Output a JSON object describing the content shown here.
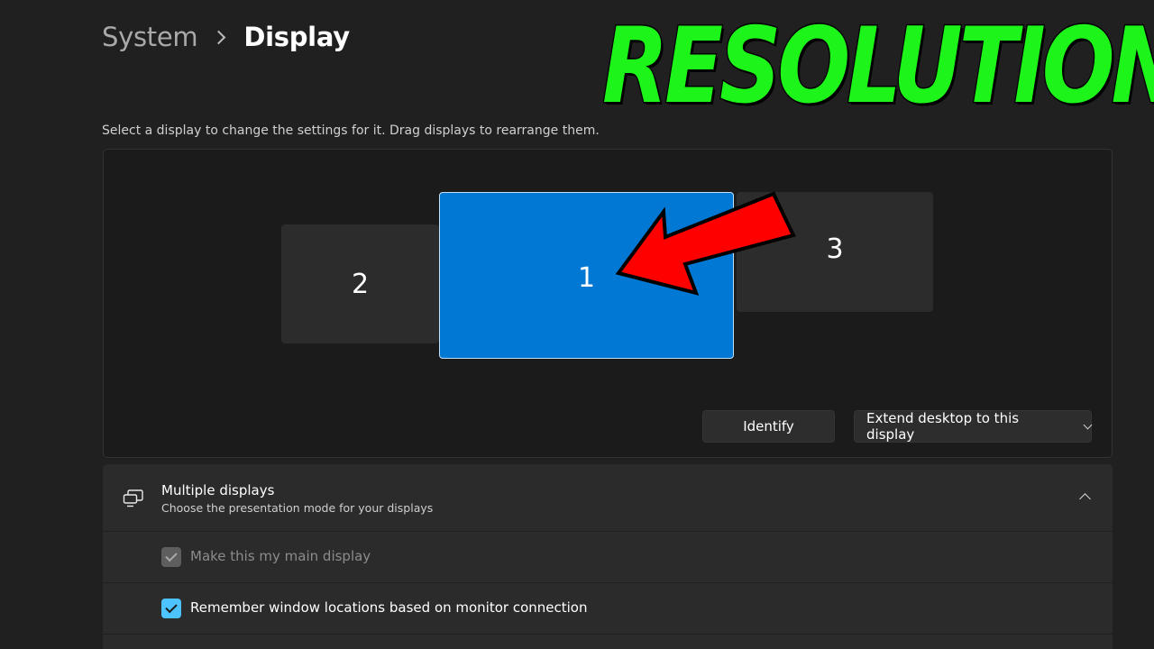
{
  "breadcrumb": {
    "parent": "System",
    "current": "Display"
  },
  "overlay_title": "RESOLUTION",
  "instruction": "Select a display to change the settings for it. Drag displays to rearrange them.",
  "monitors": {
    "left": "2",
    "center": "1",
    "right": "3"
  },
  "buttons": {
    "identify": "Identify",
    "extend": "Extend desktop to this display"
  },
  "multiple_displays": {
    "title": "Multiple displays",
    "subtitle": "Choose the presentation mode for your displays",
    "icon": "multiple-displays-icon"
  },
  "options": {
    "main_display": {
      "label": "Make this my main display",
      "checked": true,
      "disabled": true
    },
    "remember_locations": {
      "label": "Remember window locations based on monitor connection",
      "checked": true,
      "disabled": false
    }
  },
  "colors": {
    "background": "#202020",
    "accent": "#0078d4",
    "checkbox_accent": "#4cc2ff",
    "overlay_text": "#1df51a",
    "arrow": "#ff0000"
  }
}
